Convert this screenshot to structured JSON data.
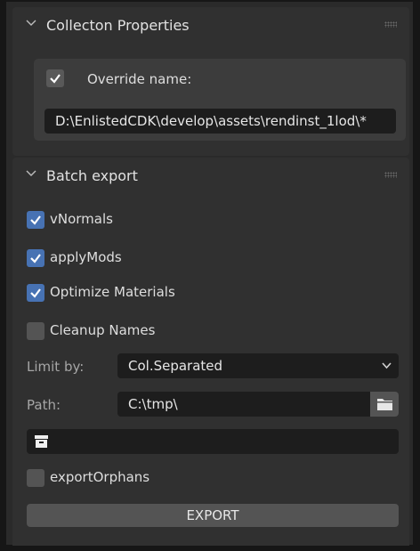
{
  "collection_properties": {
    "title": "Collecton Properties",
    "override_checked": true,
    "override_label": "Override name:",
    "override_value": "D:\\EnlistedCDK\\develop\\assets\\rendinst_1lod\\*"
  },
  "batch_export": {
    "title": "Batch export",
    "options": [
      {
        "label": "vNormals",
        "checked": true
      },
      {
        "label": "applyMods",
        "checked": true
      },
      {
        "label": "Optimize Materials",
        "checked": true
      },
      {
        "label": "Cleanup Names",
        "checked": false
      }
    ],
    "limit_by_label": "Limit by:",
    "limit_by_value": "Col.Separated",
    "path_label": "Path:",
    "path_value": "C:\\tmp\\",
    "export_orphans_label": "exportOrphans",
    "export_orphans_checked": false,
    "export_button": "EXPORT"
  },
  "colors": {
    "accent": "#4772b3",
    "panel": "#303030",
    "field": "#1d1d1d",
    "button": "#545454"
  },
  "icons": [
    "chevron-down-icon",
    "drag-grip-icon",
    "checkmark-icon",
    "folder-icon",
    "archive-icon",
    "dropdown-chevron-icon"
  ]
}
